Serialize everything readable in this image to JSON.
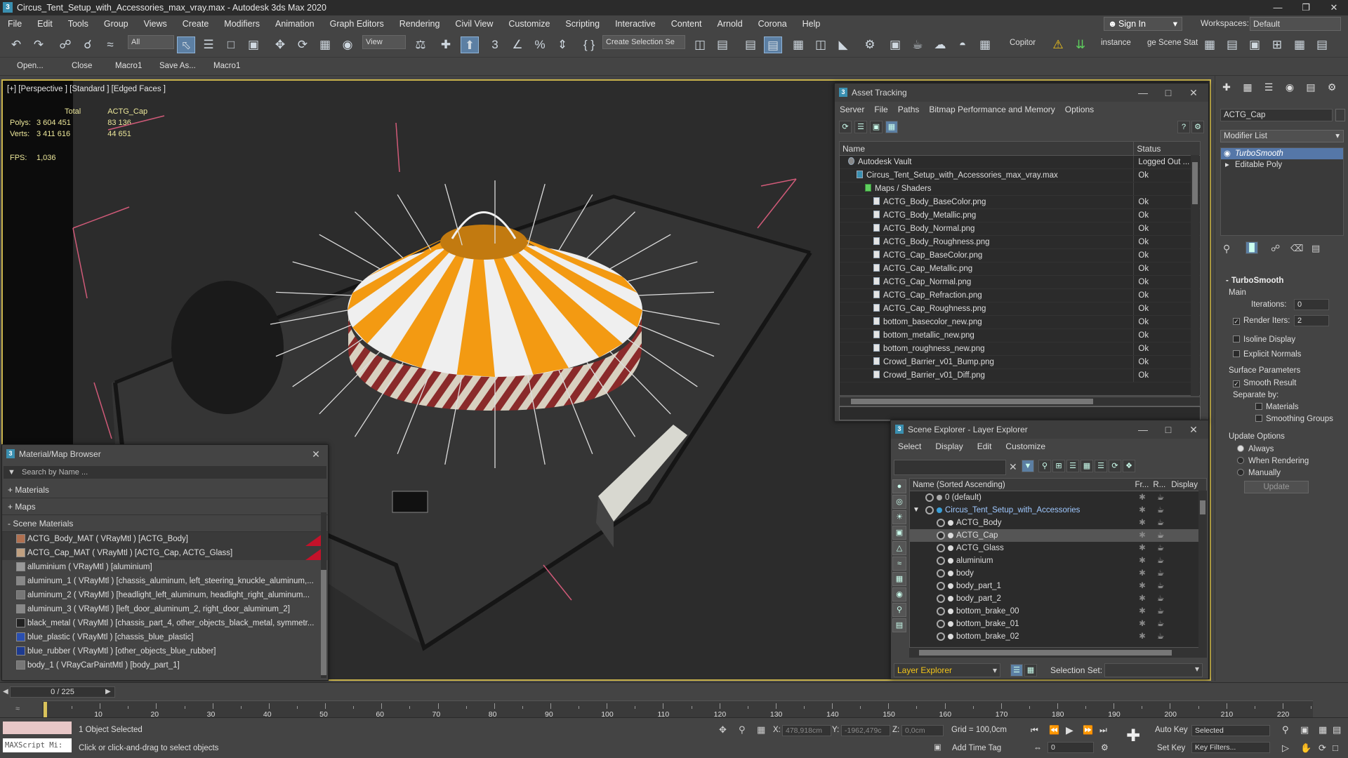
{
  "window": {
    "title": "Circus_Tent_Setup_with_Accessories_max_vray.max - Autodesk 3ds Max 2020"
  },
  "menu": [
    "File",
    "Edit",
    "Tools",
    "Group",
    "Views",
    "Create",
    "Modifiers",
    "Animation",
    "Graph Editors",
    "Rendering",
    "Civil View",
    "Customize",
    "Scripting",
    "Interactive",
    "Content",
    "Arnold",
    "Corona",
    "Help"
  ],
  "signin": "Sign In",
  "workspaces": {
    "label": "Workspaces:",
    "value": "Default"
  },
  "toolbar": {
    "filter": "All",
    "refcoord": "View",
    "selset": "Create Selection Se",
    "copitor": "Copitor",
    "instance": "instance",
    "scenestat": "ge Scene Stat"
  },
  "macros": [
    "Open...",
    "Close",
    "Macro1",
    "Save As...",
    "Macro1"
  ],
  "viewport": {
    "label": "[+] [Perspective ] [Standard ] [Edged Faces ]",
    "stats": {
      "h_total": "Total",
      "h_obj": "ACTG_Cap",
      "polys_label": "Polys:",
      "polys_total": "3 604 451",
      "polys_obj": "83 136",
      "verts_label": "Verts:",
      "verts_total": "3 411 616",
      "verts_obj": "44 651",
      "fps_label": "FPS:",
      "fps": "1,036"
    },
    "colors": {
      "stripe": "#f39a12",
      "white": "#efefef",
      "selection": "#d05a78",
      "bg": "#2c2c2c"
    }
  },
  "asset": {
    "title": "Asset Tracking",
    "menu": [
      "Server",
      "File",
      "Paths",
      "Bitmap Performance and Memory",
      "Options"
    ],
    "cols": {
      "name": "Name",
      "status": "Status"
    },
    "rows": [
      {
        "name": "Autodesk Vault",
        "status": "Logged Out ...",
        "indent": 1
      },
      {
        "name": "Circus_Tent_Setup_with_Accessories_max_vray.max",
        "status": "Ok",
        "indent": 2
      },
      {
        "name": "Maps / Shaders",
        "status": "",
        "indent": 3
      },
      {
        "name": "ACTG_Body_BaseColor.png",
        "status": "Ok",
        "indent": 4
      },
      {
        "name": "ACTG_Body_Metallic.png",
        "status": "Ok",
        "indent": 4
      },
      {
        "name": "ACTG_Body_Normal.png",
        "status": "Ok",
        "indent": 4
      },
      {
        "name": "ACTG_Body_Roughness.png",
        "status": "Ok",
        "indent": 4
      },
      {
        "name": "ACTG_Cap_BaseColor.png",
        "status": "Ok",
        "indent": 4
      },
      {
        "name": "ACTG_Cap_Metallic.png",
        "status": "Ok",
        "indent": 4
      },
      {
        "name": "ACTG_Cap_Normal.png",
        "status": "Ok",
        "indent": 4
      },
      {
        "name": "ACTG_Cap_Refraction.png",
        "status": "Ok",
        "indent": 4
      },
      {
        "name": "ACTG_Cap_Roughness.png",
        "status": "Ok",
        "indent": 4
      },
      {
        "name": "bottom_basecolor_new.png",
        "status": "Ok",
        "indent": 4
      },
      {
        "name": "bottom_metallic_new.png",
        "status": "Ok",
        "indent": 4
      },
      {
        "name": "bottom_roughness_new.png",
        "status": "Ok",
        "indent": 4
      },
      {
        "name": "Crowd_Barrier_v01_Bump.png",
        "status": "Ok",
        "indent": 4
      },
      {
        "name": "Crowd_Barrier_v01_Diff.png",
        "status": "Ok",
        "indent": 4
      }
    ]
  },
  "scene": {
    "title": "Scene Explorer - Layer Explorer",
    "menu": [
      "Select",
      "Display",
      "Edit",
      "Customize"
    ],
    "cols": {
      "name": "Name (Sorted Ascending)",
      "fr": "Fr...",
      "r": "R...",
      "display": "Display"
    },
    "rows": [
      {
        "name": "0 (default)",
        "level": 0,
        "sel": false,
        "layer": true
      },
      {
        "name": "Circus_Tent_Setup_with_Accessories",
        "level": 0,
        "sel": false,
        "layer": true,
        "blue": true
      },
      {
        "name": "ACTG_Body",
        "level": 1,
        "sel": false
      },
      {
        "name": "ACTG_Cap",
        "level": 1,
        "sel": true
      },
      {
        "name": "ACTG_Glass",
        "level": 1,
        "sel": false
      },
      {
        "name": "aluminium",
        "level": 1,
        "sel": false
      },
      {
        "name": "body",
        "level": 1,
        "sel": false
      },
      {
        "name": "body_part_1",
        "level": 1,
        "sel": false
      },
      {
        "name": "body_part_2",
        "level": 1,
        "sel": false
      },
      {
        "name": "bottom_brake_00",
        "level": 1,
        "sel": false
      },
      {
        "name": "bottom_brake_01",
        "level": 1,
        "sel": false
      },
      {
        "name": "bottom_brake_02",
        "level": 1,
        "sel": false
      }
    ],
    "footer": {
      "explorer": "Layer Explorer",
      "selset": "Selection Set:"
    }
  },
  "mat": {
    "title": "Material/Map Browser",
    "search": "Search by Name ...",
    "sections": [
      "+ Materials",
      "+ Maps",
      "- Scene Materials"
    ],
    "rows": [
      {
        "text": "ACTG_Body_MAT  ( VRayMtl )  [ACTG_Body]",
        "color": "#b07050",
        "hl": true
      },
      {
        "text": "ACTG_Cap_MAT  ( VRayMtl )  [ACTG_Cap, ACTG_Glass]",
        "color": "#c0a080",
        "hl": true
      },
      {
        "text": "alluminium  ( VRayMtl )  [aluminium]",
        "color": "#999999",
        "hl": false
      },
      {
        "text": "aluminum_1  ( VRayMtl )  [chassis_aluminum, left_steering_knuckle_aluminum,...",
        "color": "#888888",
        "hl": false
      },
      {
        "text": "aluminum_2  ( VRayMtl )  [headlight_left_aluminum, headlight_right_aluminum...",
        "color": "#777777",
        "hl": false
      },
      {
        "text": "aluminum_3  ( VRayMtl )  [left_door_aluminum_2, right_door_aluminum_2]",
        "color": "#888888",
        "hl": false
      },
      {
        "text": "black_metal  ( VRayMtl )  [chassis_part_4, other_objects_black_metal, symmetr...",
        "color": "#222222",
        "hl": false
      },
      {
        "text": "blue_plastic  ( VRayMtl )  [chassis_blue_plastic]",
        "color": "#2a4fb0",
        "hl": false
      },
      {
        "text": "blue_rubber  ( VRayMtl )  [other_objects_blue_rubber]",
        "color": "#1d3a90",
        "hl": false
      },
      {
        "text": "body_1  ( VRayCarPaintMtl )  [body_part_1]",
        "color": "#777777",
        "hl": false
      }
    ]
  },
  "rightpanel": {
    "name": "ACTG_Cap",
    "modlist": "Modifier List",
    "stack": [
      "TurboSmooth",
      "Editable Poly"
    ],
    "ts_title": "TurboSmooth",
    "main": "Main",
    "iterations_label": "Iterations:",
    "iterations": "0",
    "render_iters_label": "Render Iters:",
    "render_iters": "2",
    "isoline": "Isoline Display",
    "explicit": "Explicit Normals",
    "surface": "Surface Parameters",
    "smooth": "Smooth Result",
    "separate": "Separate by:",
    "materials": "Materials",
    "smoothing": "Smoothing Groups",
    "update_opts": "Update Options",
    "always": "Always",
    "when_render": "When Rendering",
    "manually": "Manually",
    "update": "Update"
  },
  "timeline": {
    "slider": "0 / 225",
    "ticks": [
      "10",
      "20",
      "30",
      "40",
      "50",
      "60",
      "70",
      "80",
      "90",
      "100",
      "110",
      "120",
      "130",
      "140",
      "150",
      "160",
      "170",
      "180",
      "190",
      "200",
      "210",
      "220"
    ]
  },
  "status": {
    "script": "MAXScript Mi:",
    "selected": "1 Object Selected",
    "hint": "Click or click-and-drag to select objects",
    "x_label": "X:",
    "x": "478,918cm",
    "y_label": "Y:",
    "y": "-1962,479c",
    "z_label": "Z:",
    "z": "0,0cm",
    "grid": "Grid = 100,0cm",
    "addtime": "Add Time Tag",
    "autokey": "Auto Key",
    "selected_dd": "Selected",
    "setkey": "Set Key",
    "keyfilters": "Key Filters...",
    "frame": "0"
  }
}
